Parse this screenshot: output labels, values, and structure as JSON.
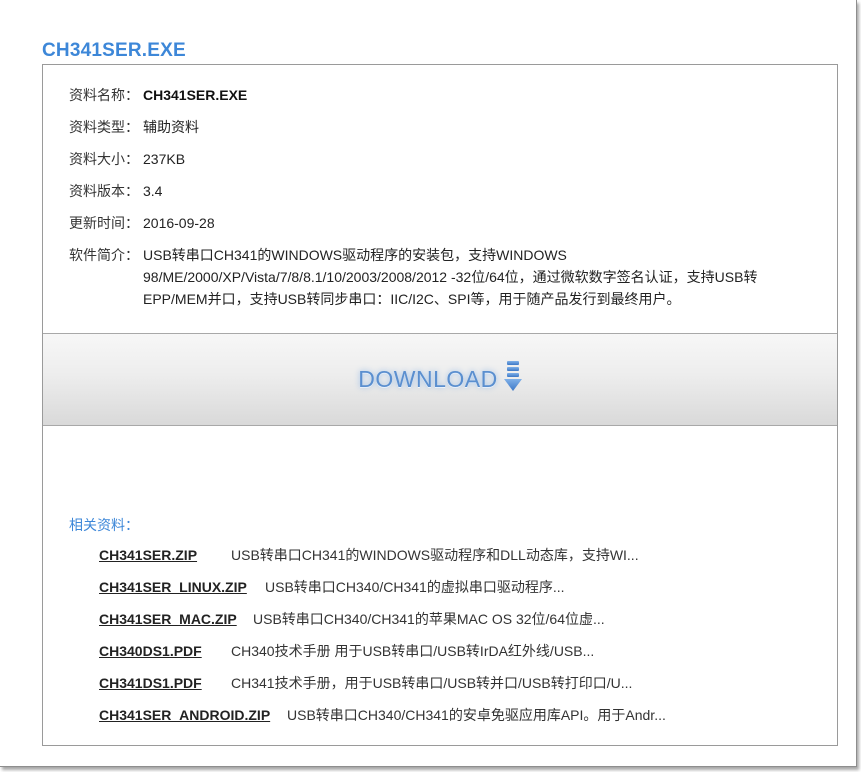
{
  "page_title": "CH341SER.EXE",
  "info": {
    "name_label": "资料名称：",
    "name_value": "CH341SER.EXE",
    "type_label": "资料类型：",
    "type_value": "辅助资料",
    "size_label": "资料大小：",
    "size_value": "237KB",
    "version_label": "资料版本：",
    "version_value": "3.4",
    "updated_label": "更新时间：",
    "updated_value": "2016-09-28",
    "desc_label": "软件简介：",
    "desc_value": "USB转串口CH341的WINDOWS驱动程序的安装包，支持WINDOWS 98/ME/2000/XP/Vista/7/8/8.1/10/2003/2008/2012 -32位/64位，通过微软数字签名认证，支持USB转EPP/MEM并口，支持USB转同步串口：IIC/I2C、SPI等，用于随产品发行到最终用户。"
  },
  "download": {
    "label": "DOWNLOAD",
    "icon": "download-arrow-icon"
  },
  "related": {
    "heading": "相关资料：",
    "items": [
      {
        "name": "CH341SER.ZIP",
        "desc": "USB转串口CH341的WINDOWS驱动程序和DLL动态库，支持WI..."
      },
      {
        "name": "CH341SER_LINUX.ZIP",
        "desc": "USB转串口CH340/CH341的虚拟串口驱动程序..."
      },
      {
        "name": "CH341SER_MAC.ZIP",
        "desc": "USB转串口CH340/CH341的苹果MAC OS 32位/64位虚..."
      },
      {
        "name": "CH340DS1.PDF",
        "desc": "CH340技术手册 用于USB转串口/USB转IrDA红外线/USB..."
      },
      {
        "name": "CH341DS1.PDF",
        "desc": "CH341技术手册，用于USB转串口/USB转并口/USB转打印口/U..."
      },
      {
        "name": "CH341SER_ANDROID.ZIP",
        "desc": "USB转串口CH340/CH341的安卓免驱应用库API。用于Andr..."
      }
    ]
  },
  "colors": {
    "accent": "#3d87d8",
    "download_text": "#5b8fcf"
  }
}
